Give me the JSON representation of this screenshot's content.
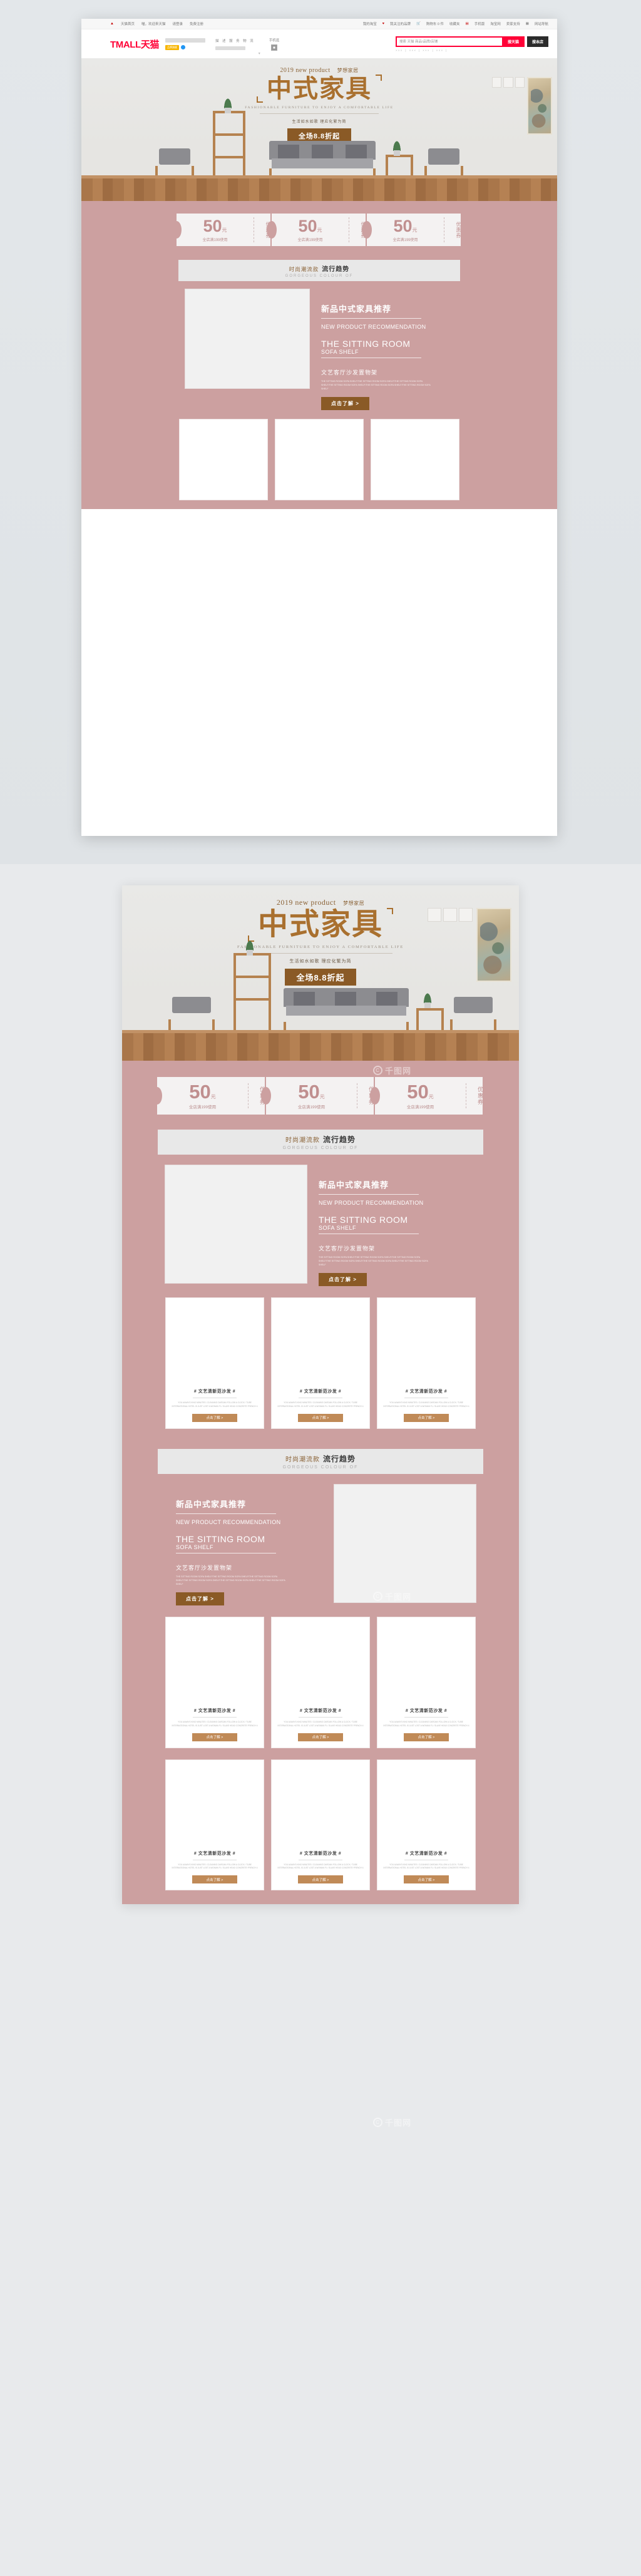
{
  "meta": {
    "page_kind": "tmall-shop-homepage-template-preview",
    "brand_accent": "#ff0036",
    "page_bg_pink": "#cca0a0",
    "wood_brown": "#8a5a26",
    "title_gold": "#a9702f"
  },
  "tmall_header": {
    "topbar_left": [
      {
        "icon": "tmall-cat-icon",
        "label": "天猫首页"
      },
      {
        "label": "喵，欢迎来天猫"
      },
      {
        "label": "请登录"
      },
      {
        "label": "免费注册"
      }
    ],
    "topbar_right": [
      {
        "label": "我的淘宝",
        "caret": "▾"
      },
      {
        "icon": "heart-icon",
        "label": "我关注的品牌"
      },
      {
        "icon": "cart-icon",
        "label": "购物车 0 件"
      },
      {
        "label": "收藏夹",
        "caret": "▾"
      },
      {
        "icon": "phone-icon",
        "label": "手机版"
      },
      {
        "label": "淘宝网"
      },
      {
        "label": "卖家支持",
        "caret": "▾"
      },
      {
        "icon": "grid-icon",
        "label": "网站导航",
        "caret": "▾"
      }
    ],
    "logo_text": "TMALL天猫",
    "shop_badge": "品牌旗舰",
    "service_label": "描 述 服 务 物 流",
    "mobile_label": "手机逛",
    "search": {
      "placeholder": "搜索 天猫 商品/品牌/店铺",
      "value": "",
      "button_tmall": "搜天猫",
      "button_shop": "搜本店",
      "hot_words": [
        "× × ×",
        "× × ×",
        "× × ×",
        "× × ×"
      ]
    }
  },
  "banner": {
    "eyebrow_en": "2019 new product",
    "eyebrow_cn": "梦想家居",
    "title_cn": "中式家具",
    "subtitle_en": "FASHIONABLE FURNITURE TO ENJOY A COMFORTABLE LIFE",
    "subtitle_cn": "生活如水如歌 理应化繁为简",
    "cta": "全场8.8折起"
  },
  "coupons": [
    {
      "amount": "50",
      "unit": "元",
      "condition": "全店满199使用",
      "vertical_label": "优惠券"
    },
    {
      "amount": "50",
      "unit": "元",
      "condition": "全店满199使用",
      "vertical_label": "优惠券"
    },
    {
      "amount": "50",
      "unit": "元",
      "condition": "全店满199使用",
      "vertical_label": "优惠券"
    }
  ],
  "section_heading": {
    "prefix_cn": "时尚潮流款",
    "main_cn": "流行趋势",
    "en": "GORGEOUS COLOUR OF"
  },
  "feature": {
    "title_cn": "新品中式家具推荐",
    "title_en": "NEW PRODUCT RECOMMENDATION",
    "line_en_big": "THE SITTING ROOM",
    "line_en_small": "SOFA SHELF",
    "desc_cn": "文艺客厅沙发置物架",
    "desc_tiny": "THE SITTING ROOM SOFA SHELF/THE SITTING ROOM SOFA SHELF/THE SITTING ROOM SOFA SHELF/THE SITTING ROOM SOFA SHELF/THE SITTING ROOM SOFA SHELF/THE SITTING ROOM SOFA SHELF",
    "button": "点击了解 >"
  },
  "product_card": {
    "title": "# 文艺清新范沙发 #",
    "tiny": "YOU ALWAYS KING MINUTES / CLEANING DAROAN FOLLOW A CLOCK / TUBE INTERNATIONAL HOTEL IS JUST LOST A WOMAN FL / SLAVE HEAD CONCRETE FRENCH 4",
    "button": "点击了解 >"
  },
  "watermark": {
    "icon": "copyright-circle-icon",
    "text": "千图网"
  }
}
